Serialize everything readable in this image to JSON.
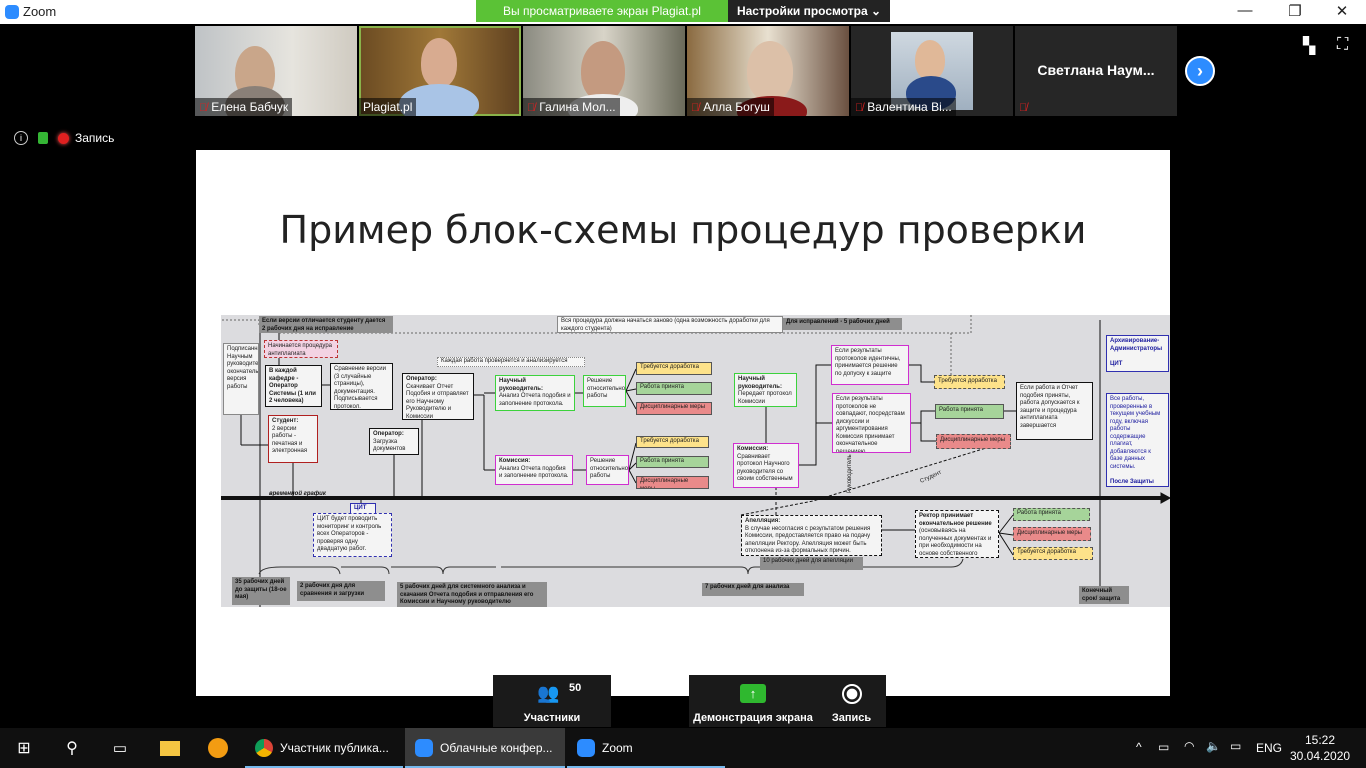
{
  "window": {
    "app_title": "Zoom",
    "share_banner": "Вы просматриваете экран Plagiat.pl",
    "view_settings": "Настройки просмотра",
    "minimize": "—",
    "restore": "❐",
    "close": "✕"
  },
  "participants": [
    {
      "name": "Елена Бабчук",
      "muted": true
    },
    {
      "name": "Plagiat.pl",
      "muted": false,
      "active": true
    },
    {
      "name": "Галина Мол...",
      "muted": true
    },
    {
      "name": "Алла Богуш",
      "muted": true
    },
    {
      "name": "Валентина Ві...",
      "muted": true
    },
    {
      "name": "Светлана  Наум...",
      "muted": true
    }
  ],
  "status": {
    "recording_label": "Запись"
  },
  "slide": {
    "title": "Пример блок-схемы процедур проверки",
    "nodes": {
      "hdr_versions": "Если версии отличается студенту дается 2 рабочих дня на исправление",
      "all_restart": "Вся процедура должна начаться заново (одна возможность доработки для каждого студента)",
      "fix_days": "Для исправлений - 5 рабочих дней",
      "signed": "Подписанная Научным руководителем окончательная версия работы",
      "start_proc": "Начинается процедура антиплагиата",
      "dept_op_title": "В каждой кафедре - Оператор Системы (1 или 2 человека)",
      "compare": "Сравнение версии (3 случайные страницы), документация. Подписывается протокол.",
      "student_title": "Студент:",
      "student_text": "2 версии работы - печатная и электронная",
      "op_upload_title": "Оператор:",
      "op_upload_text": "Загрузка документов",
      "op_dl_title": "Оператор:",
      "op_dl_text": "Скачивает Отчет Подобия и отправляет его Научному Руководителю и Комиссии",
      "each_work": "Каждая работа проверяется и анализируется",
      "sup_title": "Научный руководитель:",
      "sup_text": "Анализ Отчета подобия и заполнение протокола.",
      "decision1": "Решение относительно работы",
      "needs_rev": "Требуется доработка",
      "accepted": "Работа принята",
      "discipl": "Дисциплинарные меры",
      "sup2_title": "Научный руководитель:",
      "sup2_text": "Передает протокол Комиссии",
      "com_title": "Комиссия:",
      "com_text": "Анализ Отчета подобия и заполнение протокола.",
      "decision2": "Решение относительно работы",
      "com2_title": "Комиссия:",
      "com2_text": "Сравнивает протокол Научного руководителя со своим собственным",
      "identical": "Если результаты протоколов идентичны, принимается решение по допуску к защите",
      "not_match": "Если результаты протоколов не совпадают, посредствам дискуссии и аргументирования Комиссия принимает окончательное решениею",
      "final_ok": "Если работа и Отчет подобия приняты, работа допускается к защите и процедура антиплагиата завершается",
      "archive": "Архивирование-Администраторы",
      "cit": "ЦИТ",
      "all_works": "Все работы, проверенные в текущем учебным году, включая работы содержащие плагиат, добавляются к базе данных системы.",
      "after_def": "После Защиты",
      "timeline": "временной график",
      "cit_box": "ЦИТ",
      "cit_text": "ЦИТ будет проводить мониторинг и контроль всех Операторов - проверяя одну двадцатую работ.",
      "days35": "35 рабочих дней до защиты (18-ое мая)",
      "days2": "2 рабочих дня для сравнения и загрузки",
      "days5": "5 рабочих дней для системного анализа и скачания Отчета подобия и отправления его Комиссии и Научному руководителю",
      "appeal_title": "Апелляция:",
      "appeal_text": "В случае несогласия с результатом решения Комиссии, предоставляется право на подачу апелляции Ректору. Апелляция может быть отклонена из-за формальных причин.",
      "days10": "10 рабочих дней для апелляции",
      "days7": "7 рабочих дней для анализа",
      "rector_title": "Ректор принимает окончательное решение",
      "rector_text": "(основываясь на полученных документах и при необходимости на основе собственного анализа).",
      "deadline": "Конечный срок/ защита",
      "supervisor_vert": "Руководитель",
      "student_diag": "Студент"
    }
  },
  "controls": {
    "participants_label": "Участники",
    "participants_count": "50",
    "share_label": "Демонстрация экрана",
    "record_label": "Запись"
  },
  "taskbar": {
    "items": [
      {
        "label": "Участник публика..."
      },
      {
        "label": "Облачные конфер..."
      },
      {
        "label": "Zoom"
      }
    ],
    "lang": "ENG",
    "time": "15:22",
    "date": "30.04.2020"
  },
  "colors": {
    "zoom_blue": "#2d8cff",
    "share_green": "#5bc236",
    "supervisor_green": "#3cd23c",
    "commission_magenta": "#d02ed0"
  }
}
